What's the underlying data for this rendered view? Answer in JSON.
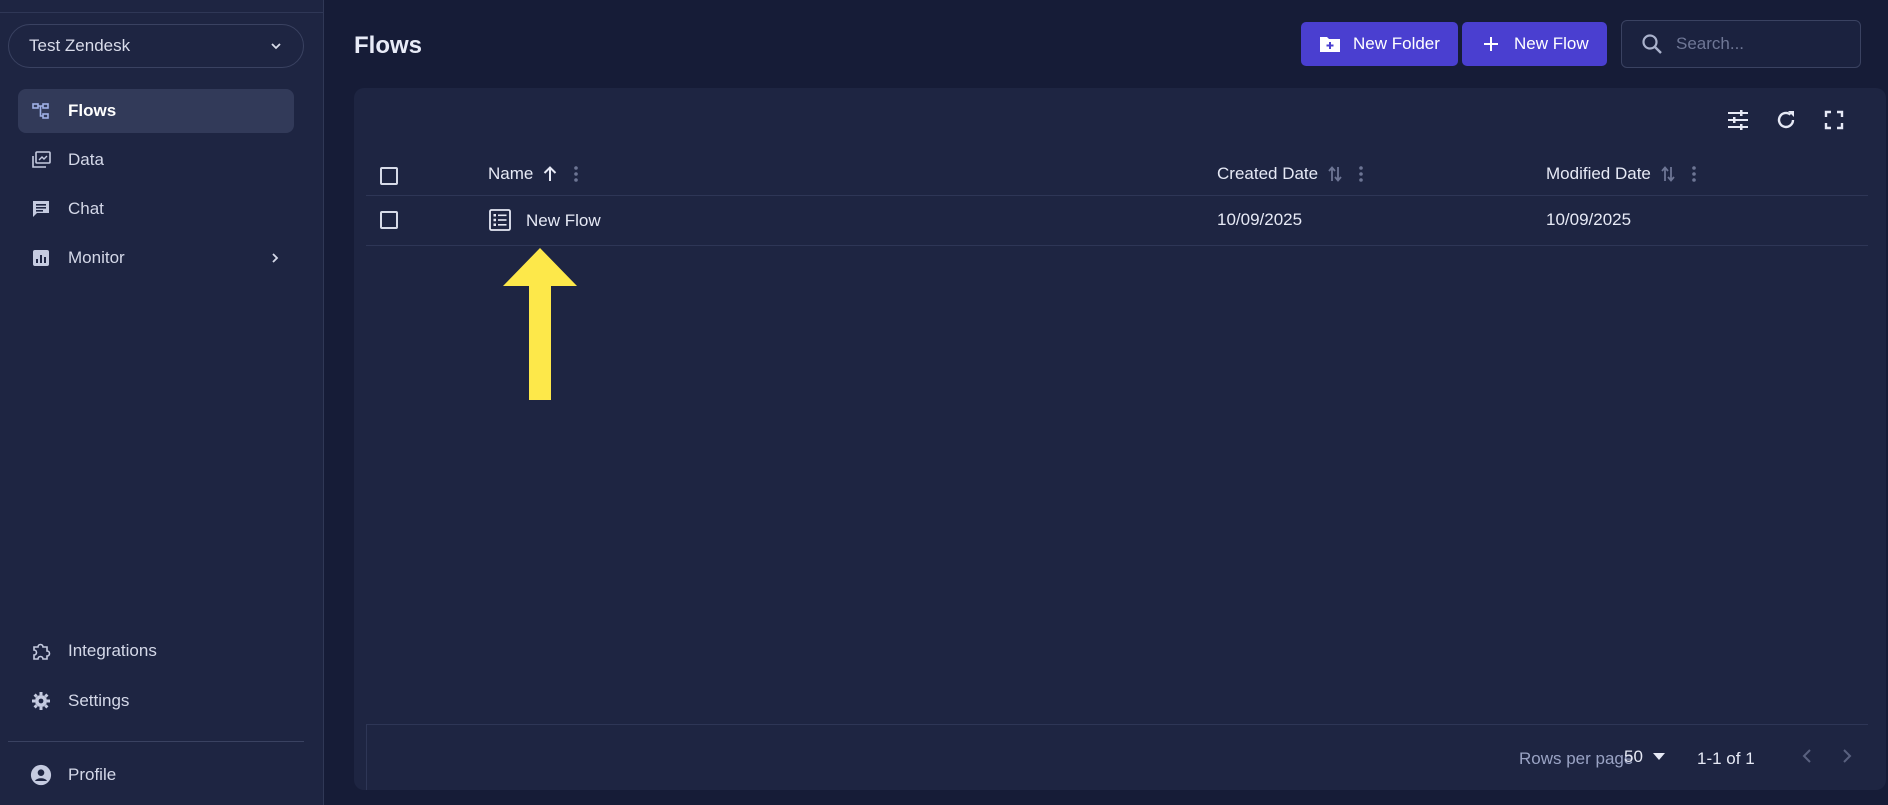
{
  "sidebar": {
    "workspace": "Test Zendesk",
    "items": [
      {
        "label": "Flows",
        "icon": "flows-icon",
        "active": true
      },
      {
        "label": "Data",
        "icon": "data-icon"
      },
      {
        "label": "Chat",
        "icon": "chat-icon"
      },
      {
        "label": "Monitor",
        "icon": "monitor-icon"
      }
    ],
    "bottom_items": [
      {
        "label": "Integrations",
        "icon": "puzzle-icon"
      },
      {
        "label": "Settings",
        "icon": "gear-icon"
      }
    ],
    "profile": "Profile"
  },
  "header": {
    "title": "Flows",
    "new_folder": "New Folder",
    "new_flow": "New Flow",
    "search_placeholder": "Search..."
  },
  "table": {
    "columns": [
      "Name",
      "Created Date",
      "Modified Date"
    ],
    "rows": [
      {
        "name": "New Flow",
        "created": "10/09/2025",
        "modified": "10/09/2025"
      }
    ]
  },
  "pagination": {
    "rows_per_page_label": "Rows per page",
    "rows_per_page": "50",
    "range": "1-1 of 1"
  },
  "colors": {
    "accent": "#4a3fd0",
    "background": "#161c37",
    "panel": "#1e2542",
    "annotation_arrow": "#fde84a"
  }
}
